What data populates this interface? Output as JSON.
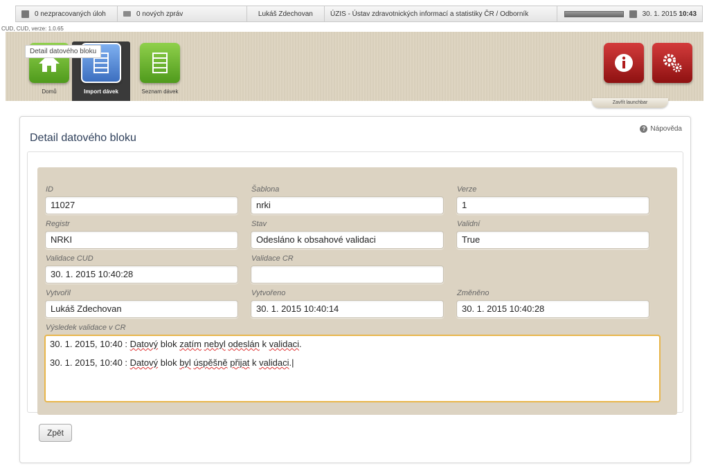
{
  "topbar": {
    "tasks": "0 nezpracovaných úloh",
    "messages": "0 nových zpráv",
    "user": "Lukáš Zdechovan",
    "organization": "ÚZIS - Ústav zdravotnických informací a statistiky ČR / Odborník",
    "date": "30. 1. 2015",
    "time": "10:43"
  },
  "version": "CUD, CUD, verze: 1.0.65",
  "launchbar": {
    "home": "Domů",
    "import": "Import dávek",
    "list": "Seznam dávek",
    "close": "Zavřít launchbar"
  },
  "page": {
    "title": "Detail datového bloku",
    "help": "Nápověda",
    "legend": "Detail datového bloku",
    "back": "Zpět"
  },
  "fields": {
    "id": {
      "label": "ID",
      "value": "11027"
    },
    "sablona": {
      "label": "Šablona",
      "value": "nrki"
    },
    "verze": {
      "label": "Verze",
      "value": "1"
    },
    "registr": {
      "label": "Registr",
      "value": "NRKI"
    },
    "stav": {
      "label": "Stav",
      "value": "Odesláno k obsahové validaci"
    },
    "validni": {
      "label": "Validní",
      "value": "True"
    },
    "validace_cud": {
      "label": "Validace CUD",
      "value": "30. 1. 2015 10:40:28"
    },
    "validace_cr": {
      "label": "Validace CR",
      "value": ""
    },
    "vytvoril": {
      "label": "Vytvořil",
      "value": "Lukáš Zdechovan"
    },
    "vytvoreno": {
      "label": "Vytvořeno",
      "value": "30. 1. 2015 10:40:14"
    },
    "zmeneno": {
      "label": "Změněno",
      "value": "30. 1. 2015 10:40:28"
    }
  },
  "result": {
    "label": "Výsledek validace v CR",
    "lines": [
      "30. 1. 2015, 10:40 : Datový blok zatím nebyl odeslán k validaci.",
      "30. 1. 2015, 10:40 : Datový blok byl úspěšně přijat k validaci."
    ]
  }
}
